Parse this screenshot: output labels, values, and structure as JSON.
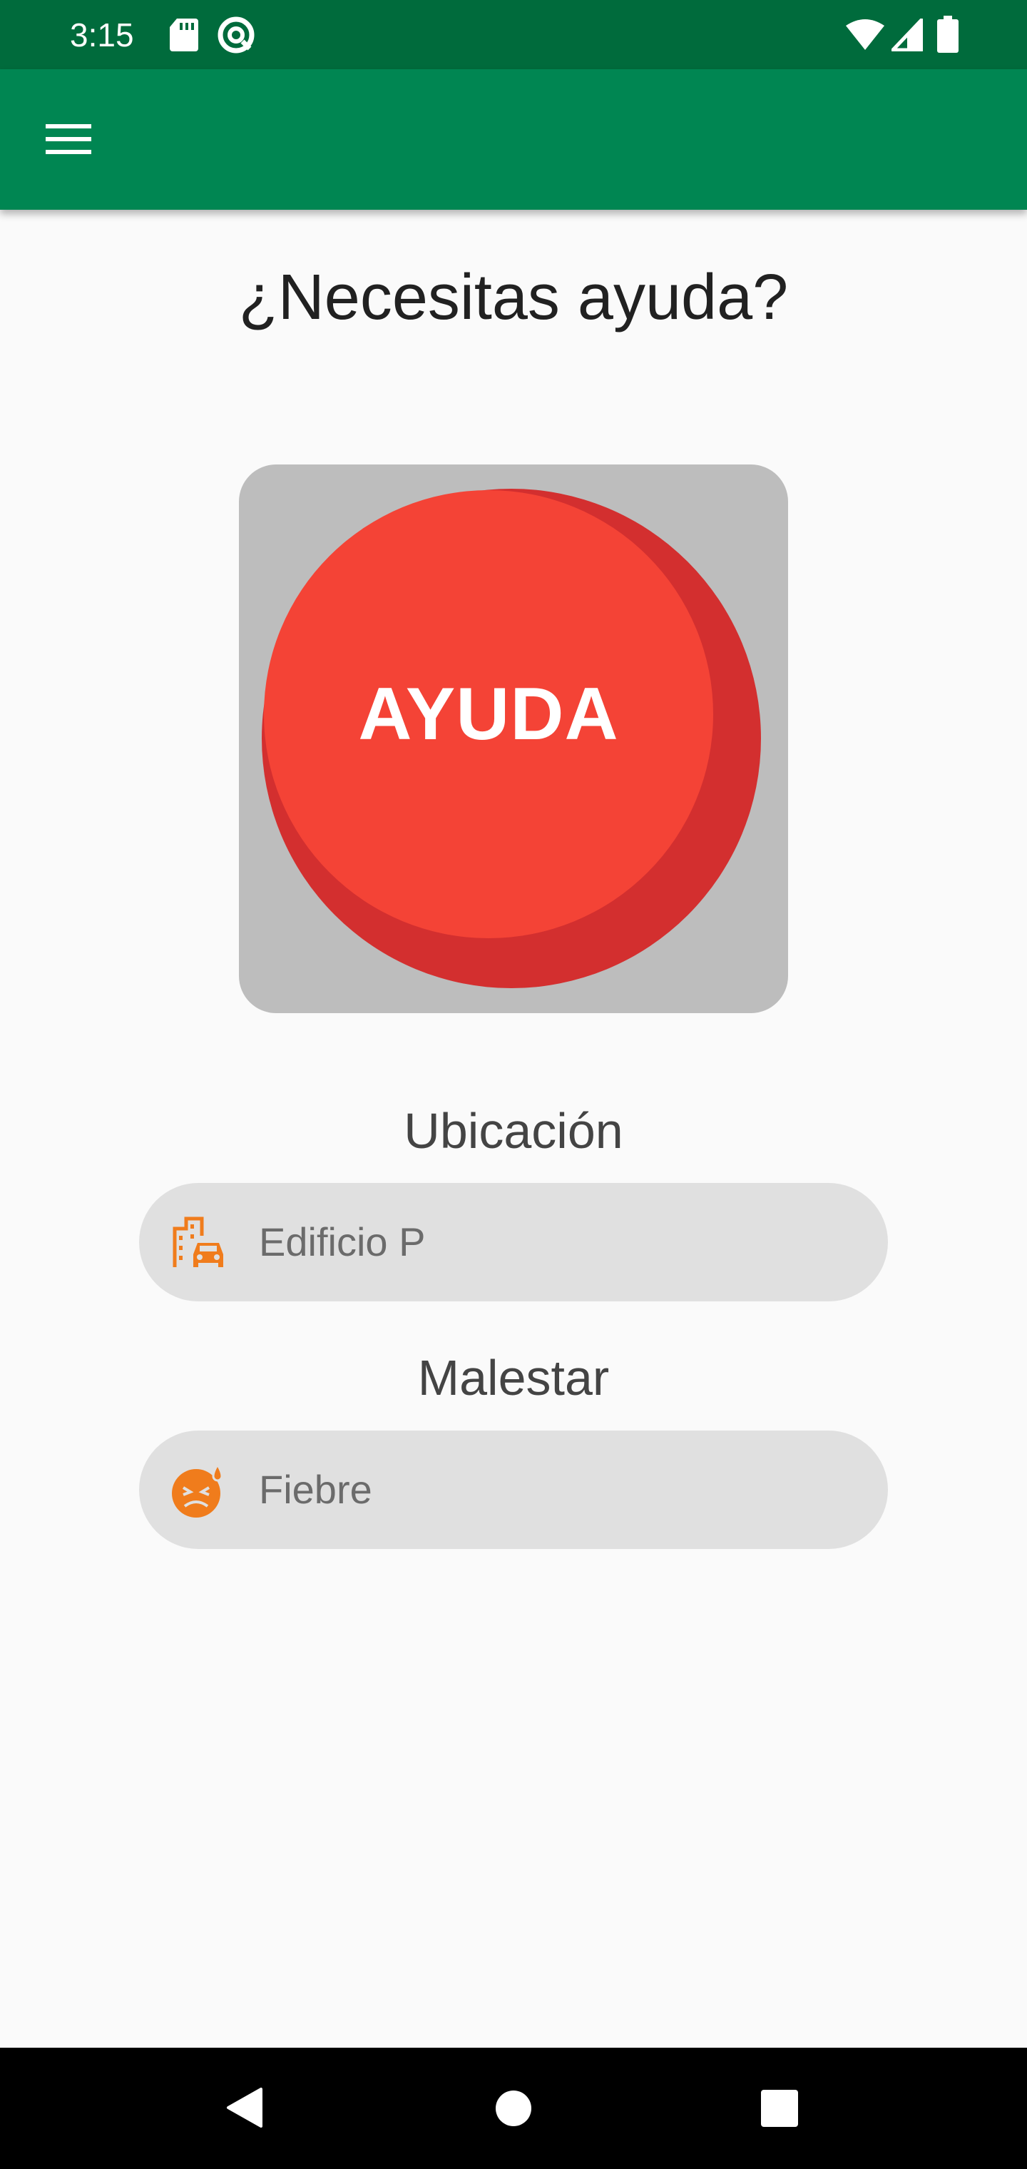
{
  "status_bar": {
    "time": "3:15",
    "icons": [
      "sd-card-icon",
      "at-sign-icon",
      "wifi-icon",
      "signal-icon",
      "battery-icon"
    ]
  },
  "app_bar": {
    "menu_icon": "hamburger-menu-icon",
    "color": "#008652"
  },
  "main": {
    "title": "¿Necesitas ayuda?",
    "help_button": {
      "label": "AYUDA",
      "color": "#f44336"
    },
    "location": {
      "label": "Ubicación",
      "value": "Edificio P",
      "icon": "building-car-icon"
    },
    "ailment": {
      "label": "Malestar",
      "value": "Fiebre",
      "icon": "sick-face-icon"
    }
  },
  "nav_bar": {
    "buttons": [
      "back-icon",
      "home-icon",
      "recents-icon"
    ]
  },
  "colors": {
    "status_bar": "#006b3c",
    "accent_icon": "#f07c1c",
    "card_gray": "#bdbdbd",
    "field_gray": "#e0e0e0"
  }
}
